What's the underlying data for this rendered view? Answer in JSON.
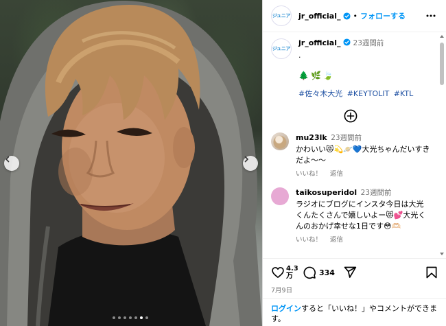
{
  "account": {
    "username": "jr_official_",
    "logo_text": "ジュニア",
    "follow_label": "フォローする",
    "separator": "•"
  },
  "caption": {
    "username": "jr_official_",
    "time": "23週間前",
    "line1": "·",
    "emojis": "🌲🌿🍃",
    "hashtags": [
      "#佐々木大光",
      "#KEYTOLIT",
      "#KTL"
    ]
  },
  "comments": [
    {
      "username": "mu23lk",
      "time": "23週間前",
      "text": "かわいい😻💫🪐💙大光ちゃんだいすきだよ〜〜",
      "like_label": "いいね！",
      "reply_label": "返信"
    },
    {
      "username": "taikosuperidol",
      "time": "23週間前",
      "text": "ラジオにブログにインスタ今日は大光くんたくさんで嬉しいよー😻💕大光くんのおかげ幸せな1日です😳🫶🏻",
      "like_label": "いいね！",
      "reply_label": "返信"
    }
  ],
  "actions": {
    "likes": "4.3万",
    "likes_line1": "4.3",
    "likes_line2": "万",
    "comments": "334",
    "date": "7月9日"
  },
  "login": {
    "link": "ログイン",
    "text": "すると「いいね！」やコメントができます。"
  },
  "carousel": {
    "total_slides": 7,
    "active_slide": 6
  },
  "colors": {
    "accent": "#0095f6",
    "hashtag": "#1e50a2",
    "muted": "#737373"
  },
  "icons": {
    "prev": "chevron-left-icon",
    "next": "chevron-right-icon",
    "more": "more-horizontal-icon",
    "like": "heart-icon",
    "comment": "comment-icon",
    "share": "share-icon",
    "save": "bookmark-icon",
    "load_more": "plus-circle-icon",
    "verified": "verified-badge-icon"
  }
}
